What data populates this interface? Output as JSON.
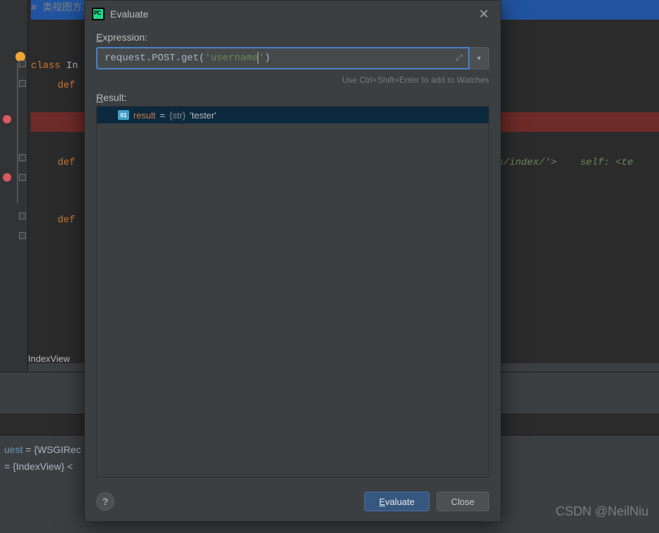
{
  "dialog": {
    "title": "Evaluate",
    "expression_label": "Expression:",
    "expression_plain": "request.POST.get('username')",
    "hint": "Use Ctrl+Shift+Enter to add to Watches",
    "result_label": "Result:",
    "result": {
      "name": "result",
      "type": "{str}",
      "value": "'tester'"
    },
    "buttons": {
      "evaluate": "Evaluate",
      "close": "Close"
    },
    "help": "?"
  },
  "editor": {
    "comment": "# 类视图方… ………",
    "class_kw": "class ",
    "class_name": "In",
    "def_kw": "def ",
    "hint_right": "s/index/'>    self: <te",
    "tab": "IndexView"
  },
  "vars": {
    "line1_pre": "uest",
    "line1_rest": " = {WSGIRec",
    "line2_pre": " = {IndexView} <"
  },
  "watermark": "CSDN @NeilNiu"
}
